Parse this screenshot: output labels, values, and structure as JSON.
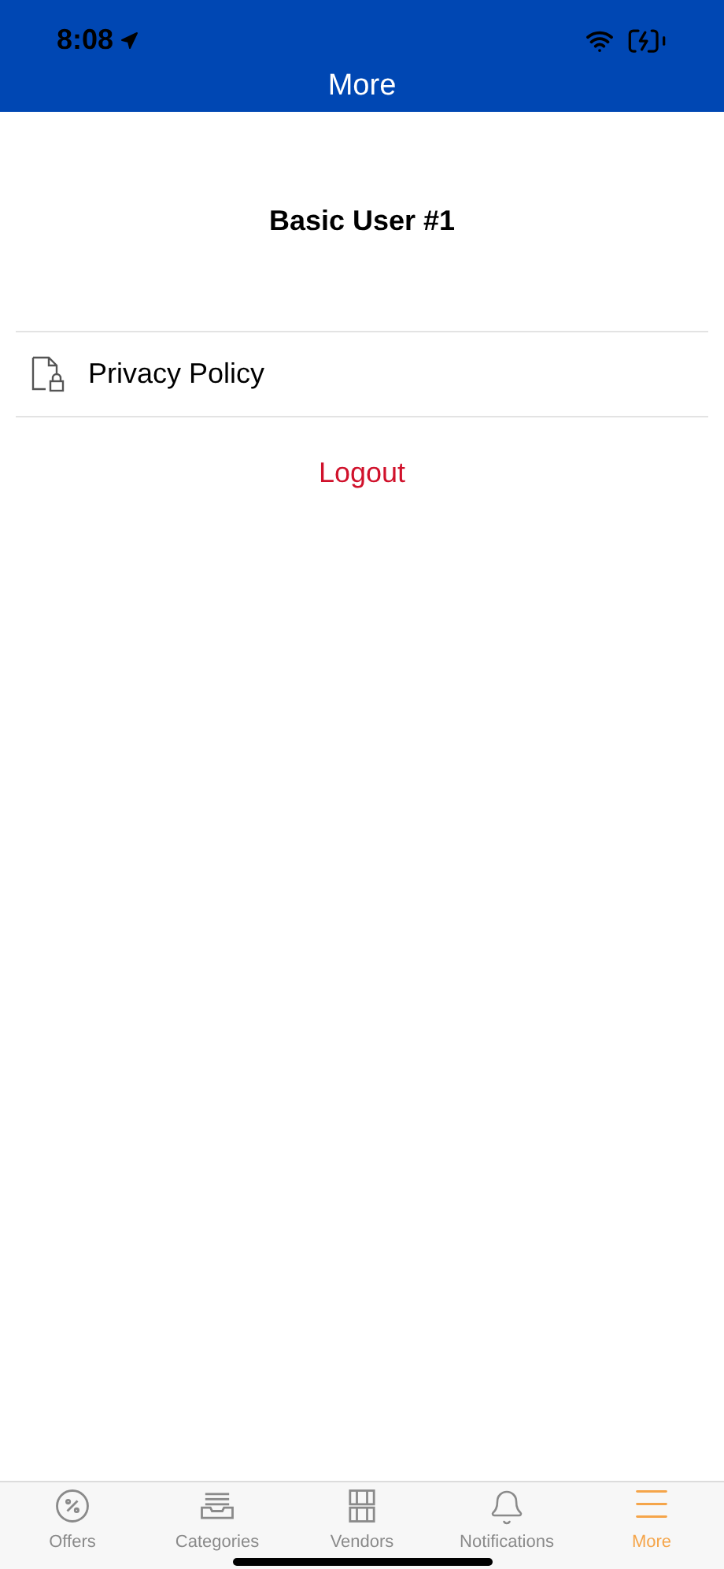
{
  "status_bar": {
    "time": "8:08"
  },
  "header": {
    "title": "More"
  },
  "user": {
    "name": "Basic User #1"
  },
  "menu": [
    {
      "label": "Privacy Policy"
    }
  ],
  "logout": {
    "label": "Logout"
  },
  "tab_bar": [
    {
      "label": "Offers",
      "selected": false
    },
    {
      "label": "Categories",
      "selected": false
    },
    {
      "label": "Vendors",
      "selected": false
    },
    {
      "label": "Notifications",
      "selected": false
    },
    {
      "label": "More",
      "selected": true
    }
  ]
}
